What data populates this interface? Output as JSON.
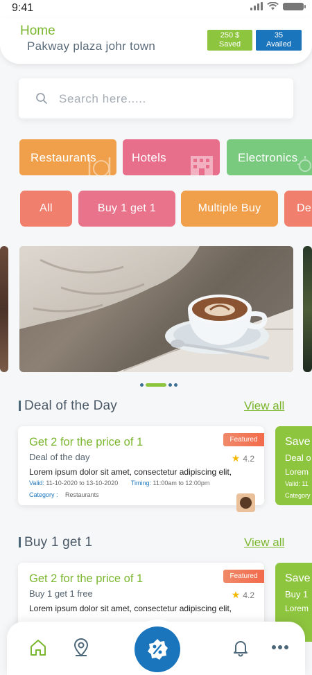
{
  "status_bar": {
    "time": "9:41"
  },
  "header": {
    "title": "Home",
    "location": "Pakway plaza johr town",
    "saved": {
      "value": "250 $",
      "label": "Saved"
    },
    "availed": {
      "value": "35",
      "label": "Availed"
    }
  },
  "search": {
    "placeholder": "Search here....."
  },
  "categories": [
    {
      "label": "Restaurants",
      "color": "#f0a04b",
      "icon": "utensils-icon"
    },
    {
      "label": "Hotels",
      "color": "#e86f8c",
      "icon": "building-icon"
    },
    {
      "label": "Electronics",
      "color": "#79c97f",
      "icon": "bulb-icon"
    }
  ],
  "filters": [
    {
      "label": "All",
      "color": "#f07f6d"
    },
    {
      "label": "Buy 1 get 1",
      "color": "#e8738a"
    },
    {
      "label": "Multiple Buy",
      "color": "#f0a04b"
    },
    {
      "label": "De",
      "color": "#f07f6d"
    }
  ],
  "sections": {
    "deal_of_day": {
      "title": "Deal of the Day",
      "view_all": "View all"
    },
    "buy1get1": {
      "title": "Buy 1 get 1",
      "view_all": "View all"
    }
  },
  "deal_card": {
    "title": "Get 2 for the price of 1",
    "subtitle": "Deal of the day",
    "featured": "Featured",
    "rating": "4.2",
    "description": "Lorem ipsum dolor sit amet, consectetur adipiscing elit,",
    "valid_label": "Valid:",
    "valid_value": "11-10-2020 to 13-10-2020",
    "timing_label": "Timing:",
    "timing_value": "11:00am to 12:00pm",
    "category_label": "Category :",
    "category_value": "Restaurants"
  },
  "deal_peek": {
    "title": "Save",
    "subtitle": "Deal o",
    "description": "Lorem",
    "valid_label": "Valid:",
    "valid_value": "11",
    "category_label": "Category"
  },
  "b1g1_card": {
    "title": "Get 2 for the price of 1",
    "subtitle": "Buy 1 get 1 free",
    "featured": "Featured",
    "rating": "4.2",
    "description": "Lorem ipsum dolor sit amet, consectetur adipiscing elit,"
  },
  "b1g1_peek": {
    "title": "Save",
    "subtitle": "Buy 1",
    "description": "Lorem"
  },
  "nav": {
    "items": [
      "home-icon",
      "location-pin-icon",
      "discount-badge-icon",
      "bell-icon",
      "more-icon"
    ],
    "active": "home-icon",
    "accent": "#7ab62e",
    "primary": "#1b75bc"
  }
}
